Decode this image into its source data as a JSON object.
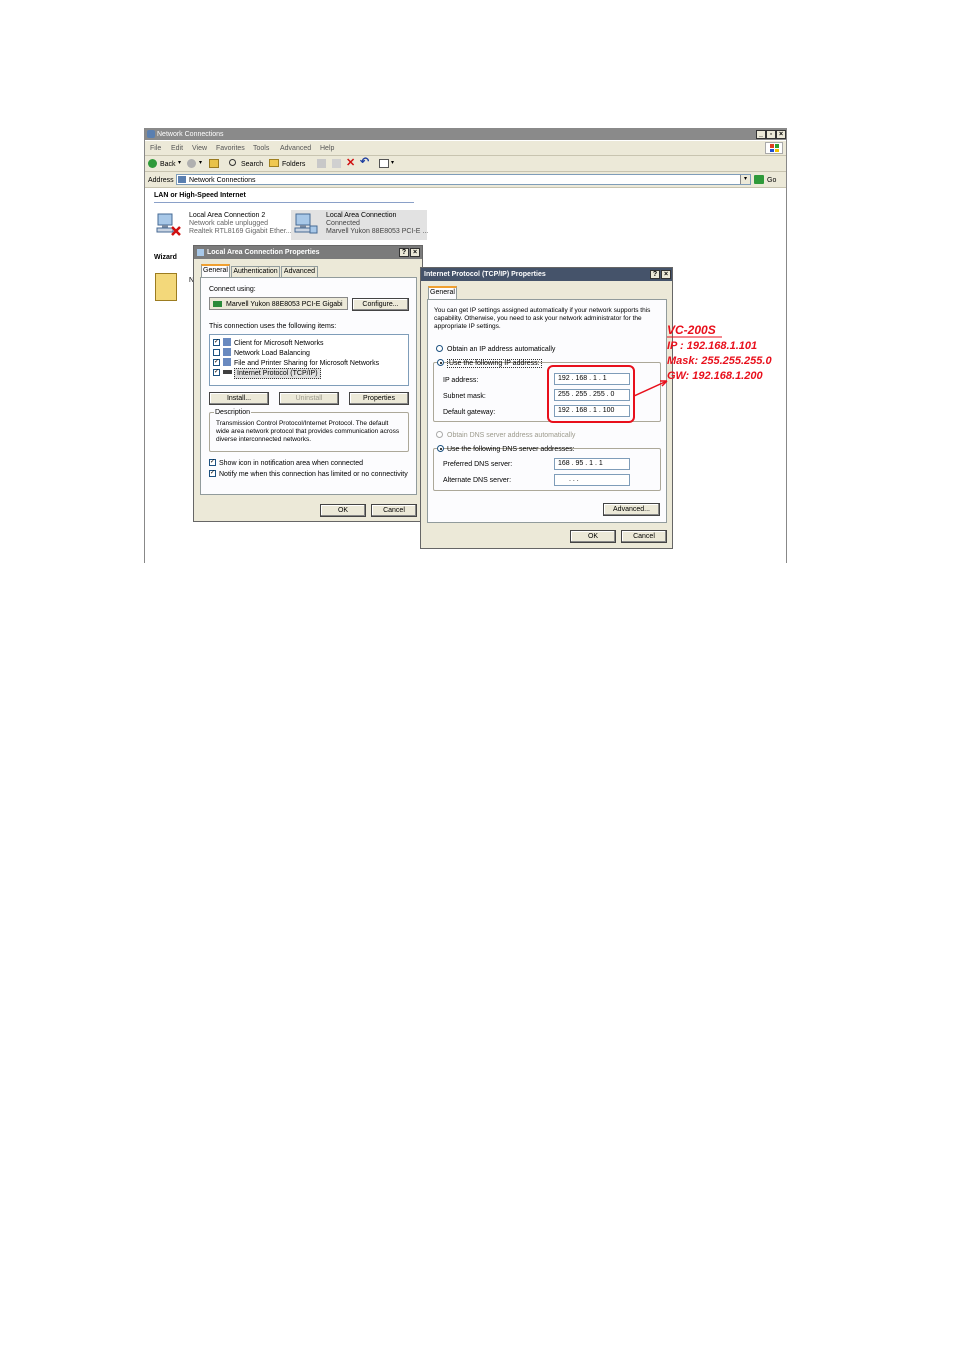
{
  "explorer": {
    "title": "Network Connections",
    "menu": [
      "File",
      "Edit",
      "View",
      "Favorites",
      "Tools",
      "Advanced",
      "Help"
    ],
    "toolbar": {
      "back": "Back",
      "search": "Search",
      "folders": "Folders"
    },
    "address_label": "Address",
    "address_value": "Network Connections",
    "go_label": "Go",
    "section_lan": "LAN or High-Speed Internet",
    "section_wizard": "Wizard",
    "wizard_item_partial": "N",
    "connections": [
      {
        "name": "Local Area Connection 2",
        "status": "Network cable unplugged",
        "device": "Realtek RTL8169 Gigabit Ether..."
      },
      {
        "name": "Local Area Connection",
        "status": "Connected",
        "device": "Marvell Yukon 88E8053 PCI-E ..."
      }
    ]
  },
  "lac_dialog": {
    "title": "Local Area Connection Properties",
    "tabs": [
      "General",
      "Authentication",
      "Advanced"
    ],
    "connect_using_label": "Connect using:",
    "adapter": "Marvell Yukon 88E8053 PCI-E Gigabi",
    "configure": "Configure...",
    "items_label": "This connection uses the following items:",
    "items": [
      {
        "label": "Client for Microsoft Networks",
        "checked": true
      },
      {
        "label": "Network Load Balancing",
        "checked": false
      },
      {
        "label": "File and Printer Sharing for Microsoft Networks",
        "checked": true
      },
      {
        "label": "Internet Protocol (TCP/IP)",
        "checked": true
      }
    ],
    "install": "Install...",
    "uninstall": "Uninstall",
    "properties": "Properties",
    "description_label": "Description",
    "description": "Transmission Control Protocol/Internet Protocol. The default wide area network protocol that provides communication across diverse interconnected networks.",
    "show_icon": "Show icon in notification area when connected",
    "notify": "Notify me when this connection has limited or no connectivity",
    "ok": "OK",
    "cancel": "Cancel"
  },
  "tcp_dialog": {
    "title": "Internet Protocol (TCP/IP) Properties",
    "tab": "General",
    "info": "You can get IP settings assigned automatically if your network supports this capability. Otherwise, you need to ask your network administrator for the appropriate IP settings.",
    "obtain_auto": "Obtain an IP address automatically",
    "use_following": "Use the following IP address:",
    "ip_label": "IP address:",
    "ip_value": "192 . 168 .  1  .  1",
    "mask_label": "Subnet mask:",
    "mask_value": "255 . 255 . 255 .  0",
    "gw_label": "Default gateway:",
    "gw_value": "192 . 168 .  1  . 100",
    "obtain_dns": "Obtain DNS server address automatically",
    "use_dns": "Use the following DNS server addresses:",
    "pref_dns_label": "Preferred DNS server:",
    "pref_dns_value": "168 .  95 .  1  .  1",
    "alt_dns_label": "Alternate DNS server:",
    "alt_dns_value": ".      .      .",
    "advanced": "Advanced...",
    "ok": "OK",
    "cancel": "Cancel"
  },
  "annotation": {
    "device": "VC-200S",
    "ip": "IP : 192.168.1.101",
    "mask": "Mask: 255.255.255.0",
    "gw": "GW: 192.168.1.200",
    "color": "#e8101c"
  }
}
